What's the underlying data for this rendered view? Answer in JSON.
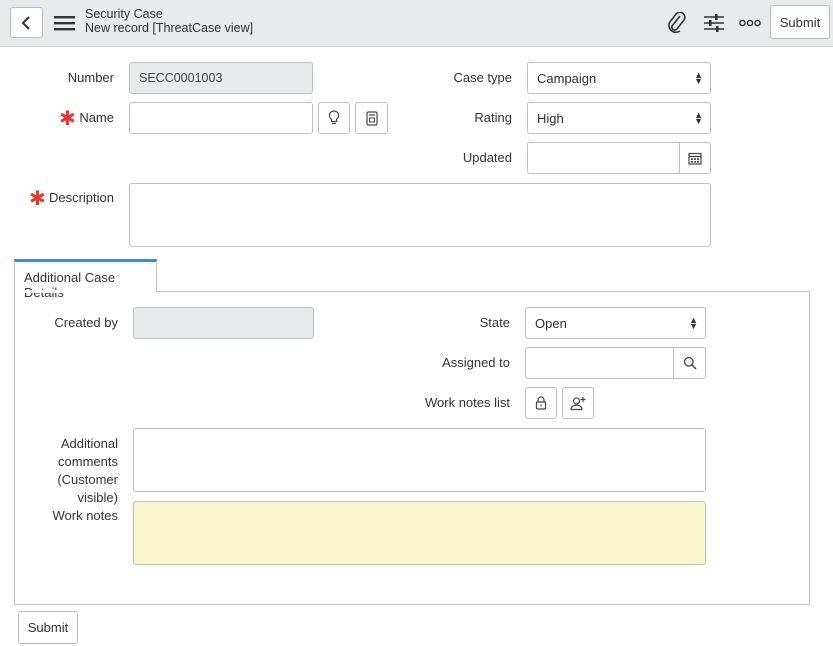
{
  "header": {
    "title": "Security Case",
    "subtitle": "New record [ThreatCase view]",
    "submit_label": "Submit",
    "icons": [
      "back-icon",
      "menu-icon",
      "paperclip-icon",
      "sliders-icon",
      "more-icon"
    ]
  },
  "form": {
    "number": {
      "label": "Number",
      "value": "SECC0001003"
    },
    "name": {
      "label": "Name",
      "value": ""
    },
    "case_type": {
      "label": "Case type",
      "value": "Campaign"
    },
    "rating": {
      "label": "Rating",
      "value": "High"
    },
    "updated": {
      "label": "Updated",
      "value": ""
    },
    "description": {
      "label": "Description",
      "value": ""
    }
  },
  "section": {
    "tab_label": "Additional Case Details",
    "created_by": {
      "label": "Created by",
      "value": ""
    },
    "state": {
      "label": "State",
      "value": "Open"
    },
    "assigned_to": {
      "label": "Assigned to",
      "value": ""
    },
    "work_notes_list": {
      "label": "Work notes list"
    },
    "additional_comments": {
      "label_line1": "Additional",
      "label_line2": "comments",
      "label_line3": "(Customer visible)"
    },
    "work_notes": {
      "label": "Work notes"
    }
  },
  "footer": {
    "submit_label": "Submit"
  },
  "colors": {
    "required": "#e03c31",
    "tab_accent": "#278efc",
    "work_notes_bg": "#faf6cc"
  }
}
